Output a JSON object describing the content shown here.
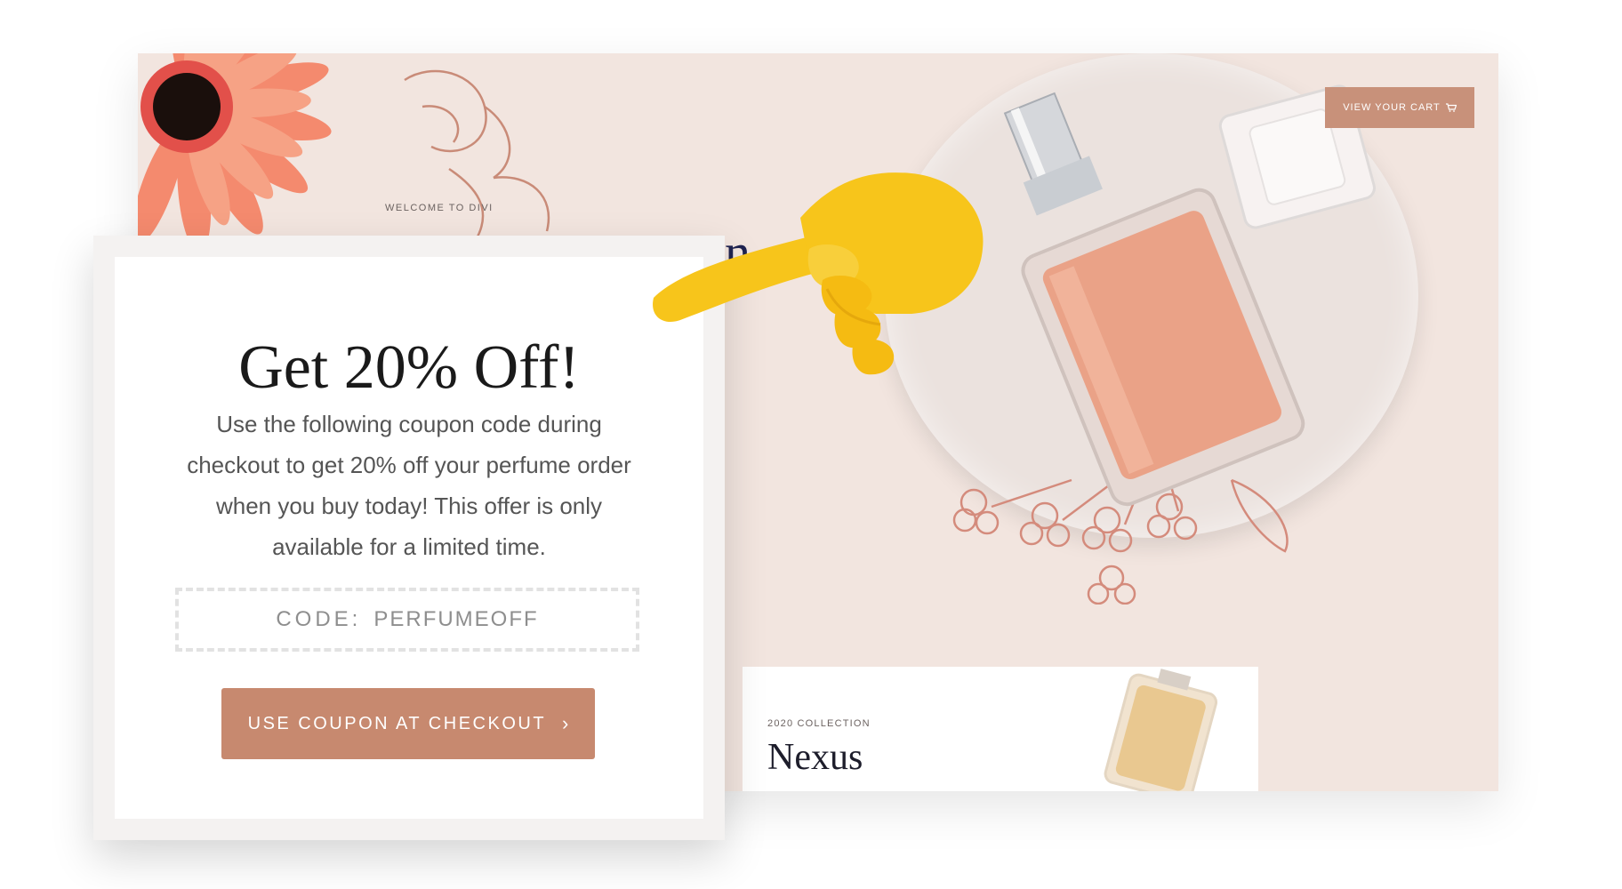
{
  "site": {
    "welcome": "WELCOME TO DIVI",
    "headline_peek": "n",
    "cart_button": "VIEW YOUR CART",
    "cart_icon": "cart-icon",
    "collection": {
      "label": "2020 COLLECTION",
      "title": "Nexus"
    }
  },
  "popup": {
    "title": "Get 20% Off!",
    "text": "Use the following coupon code during checkout to get 20% off your perfume order when you buy today! This offer is only available for a limited time.",
    "coupon_label": "CODE:",
    "coupon_code": "PERFUMEOFF",
    "button_label": "USE COUPON AT CHECKOUT",
    "button_icon": "chevron-right-icon",
    "button_chevron": "›"
  },
  "colors": {
    "accent": "#c7896f",
    "site_bg": "#f2e5df",
    "hand": "#f7c51b"
  }
}
